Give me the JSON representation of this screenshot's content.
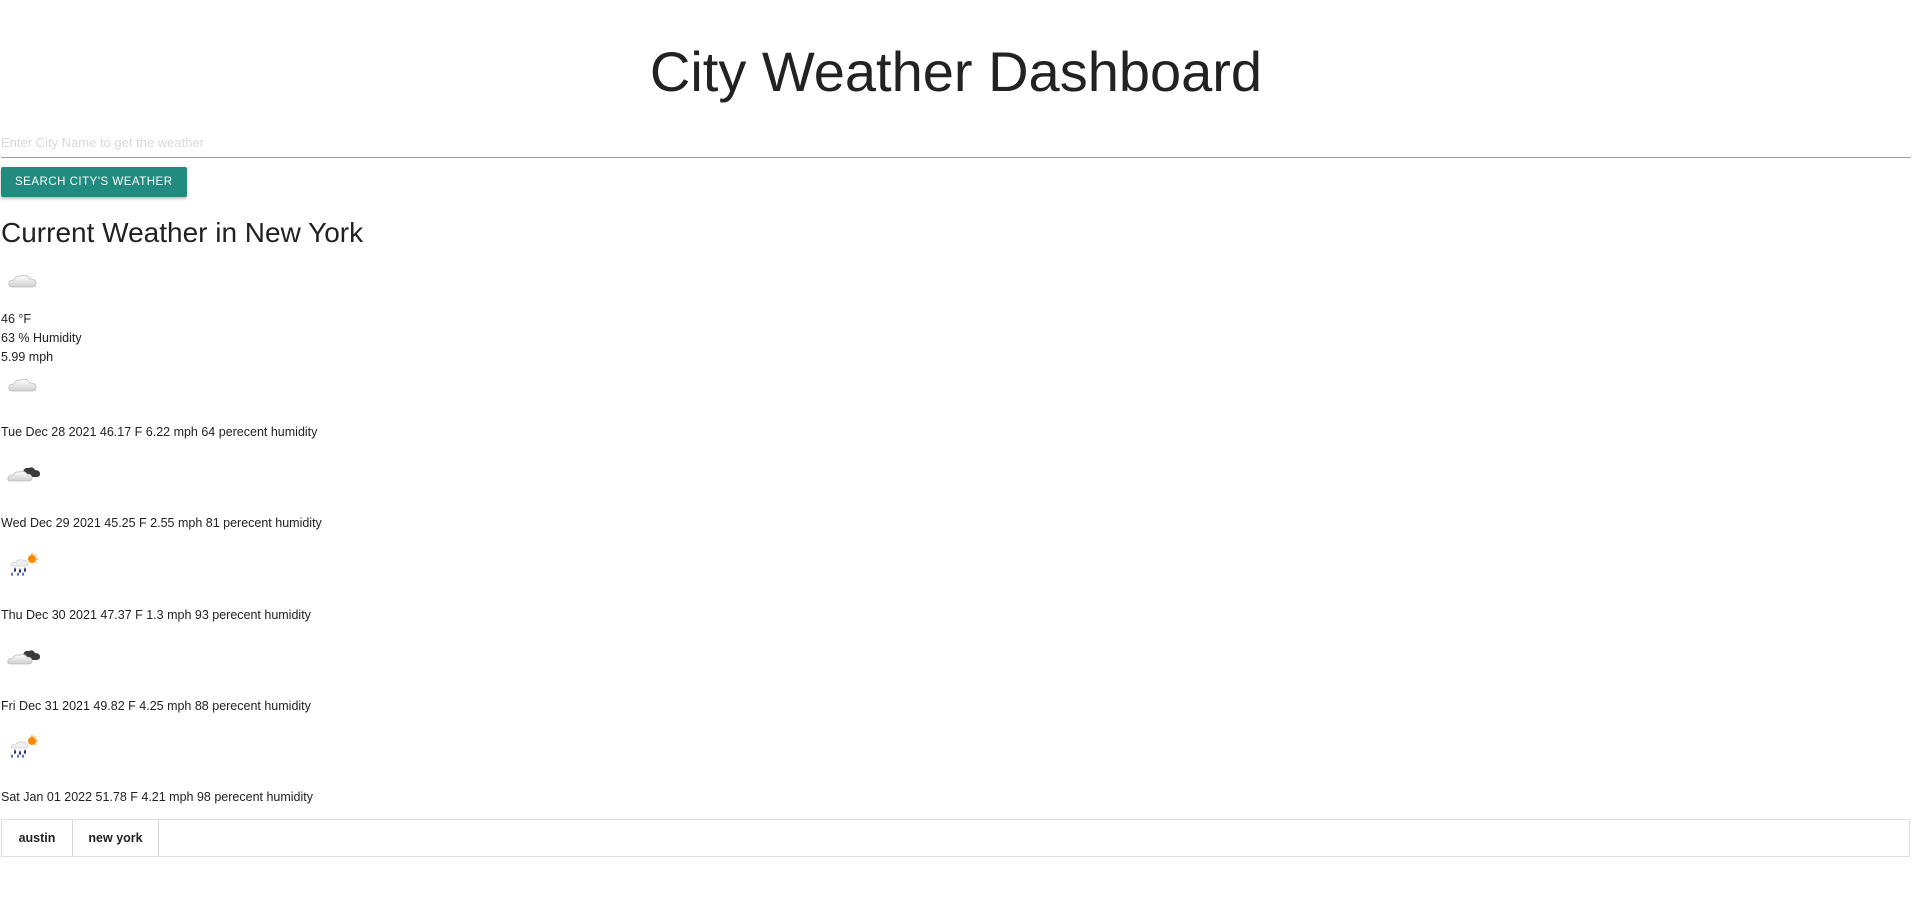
{
  "header": {
    "title": "City Weather Dashboard"
  },
  "search": {
    "placeholder": "Enter City Name to get the weather",
    "value": "",
    "button_label": "SEARCH CITY'S WEATHER",
    "button_color": "#218b80"
  },
  "current": {
    "heading": "Current Weather in New York",
    "icon": "cloud-icon",
    "temperature": "46 °F",
    "humidity": "63 % Humidity",
    "wind": "5.99 mph"
  },
  "forecast": [
    {
      "icon": "cloud-icon",
      "text": "Tue Dec 28 2021 46.17 F 6.22 mph 64 perecent humidity"
    },
    {
      "icon": "broken-clouds-icon",
      "text": "Wed Dec 29 2021 45.25 F 2.55 mph 81 perecent humidity"
    },
    {
      "icon": "rain-sun-icon",
      "text": "Thu Dec 30 2021 47.37 F 1.3 mph 93 perecent humidity"
    },
    {
      "icon": "broken-clouds-icon",
      "text": "Fri Dec 31 2021 49.82 F 4.25 mph 88 perecent humidity"
    },
    {
      "icon": "rain-sun-icon",
      "text": "Sat Jan 01 2022 51.78 F 4.21 mph 98 perecent humidity"
    }
  ],
  "history": {
    "items": [
      "austin",
      "new york"
    ]
  }
}
